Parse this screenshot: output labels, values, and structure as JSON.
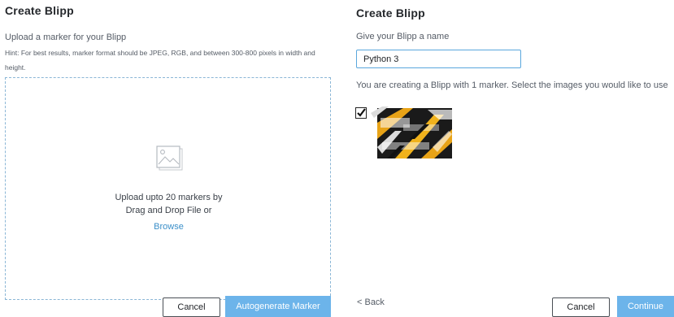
{
  "left": {
    "title": "Create Blipp",
    "subtitle": "Upload a marker for your Blipp",
    "hint": "Hint: For best results, marker format should be JPEG, RGB, and between 300-800 pixels in width and height.",
    "dropzone": {
      "line1": "Upload upto 20 markers by",
      "line2": "Drag and Drop File or",
      "browse": "Browse"
    },
    "cancel": "Cancel",
    "autogenerate": "Autogenerate Marker"
  },
  "right": {
    "title": "Create Blipp",
    "name_label": "Give your Blipp a name",
    "name_value": "Python 3",
    "info": "You are creating a Blipp with 1 marker. Select the images you would like to use",
    "marker_checked": true,
    "back": "< Back",
    "cancel": "Cancel",
    "continue": "Continue"
  },
  "colors": {
    "primary_button": "#6cb4ea",
    "link": "#3b8fc9",
    "dropzone_border": "#8ab6d6"
  },
  "icons": [
    "image-placeholder-icon",
    "checkmark-icon"
  ]
}
